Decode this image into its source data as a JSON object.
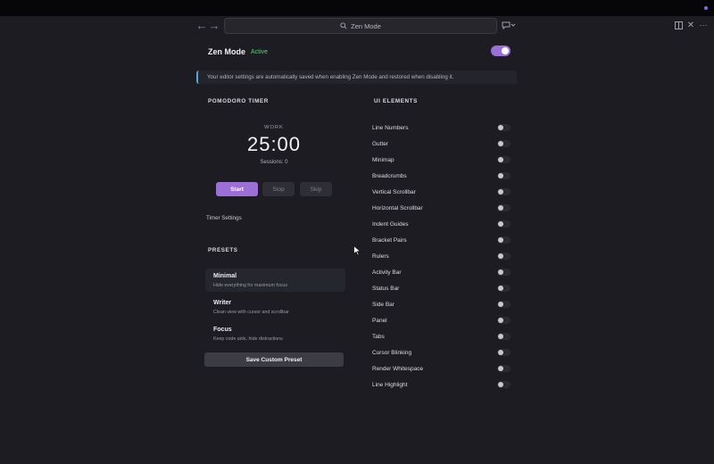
{
  "search": {
    "text": "Zen Mode"
  },
  "zen": {
    "title": "Zen Mode",
    "badge": "Active",
    "enabled": true
  },
  "info": {
    "text": "Your editor settings are automatically saved when enabling Zen Mode and restored when disabling it."
  },
  "pomodoro": {
    "section_title": "POMODORO TIMER",
    "mode": "WORK",
    "time": "25:00",
    "sessions": "Sessions: 0",
    "start_label": "Start",
    "stop_label": "Stop",
    "skip_label": "Skip",
    "settings_label": "Timer Settings"
  },
  "presets": {
    "section_title": "PRESETS",
    "items": [
      {
        "name": "Minimal",
        "desc": "Hide everything for maximum focus"
      },
      {
        "name": "Writer",
        "desc": "Clean view with cursor and scrollbar"
      },
      {
        "name": "Focus",
        "desc": "Keep code aids, hide distractions"
      }
    ],
    "save_label": "Save Custom Preset"
  },
  "ui_elements": {
    "section_title": "UI ELEMENTS",
    "items": [
      {
        "label": "Line Numbers",
        "on": false
      },
      {
        "label": "Gutter",
        "on": false
      },
      {
        "label": "Minimap",
        "on": false
      },
      {
        "label": "Breadcrumbs",
        "on": false
      },
      {
        "label": "Vertical Scrollbar",
        "on": false
      },
      {
        "label": "Horizontal Scrollbar",
        "on": false
      },
      {
        "label": "Indent Guides",
        "on": false
      },
      {
        "label": "Bracket Pairs",
        "on": false
      },
      {
        "label": "Rulers",
        "on": false
      },
      {
        "label": "Activity Bar",
        "on": false
      },
      {
        "label": "Status Bar",
        "on": false
      },
      {
        "label": "Side Bar",
        "on": false
      },
      {
        "label": "Panel",
        "on": false
      },
      {
        "label": "Tabs",
        "on": false
      },
      {
        "label": "Cursor Blinking",
        "on": false
      },
      {
        "label": "Render Whitespace",
        "on": false
      },
      {
        "label": "Line Highlight",
        "on": false
      }
    ]
  },
  "icons": {
    "back": "arrow-left-icon",
    "forward": "arrow-right-icon",
    "search": "search-icon",
    "copilot": "chat-icon",
    "layout": "split-layout-icon",
    "close": "close-icon",
    "more": "more-icon"
  },
  "colors": {
    "accent": "#9c6fd6",
    "active_badge": "#5fd088",
    "info_border": "#4ea9d8"
  }
}
